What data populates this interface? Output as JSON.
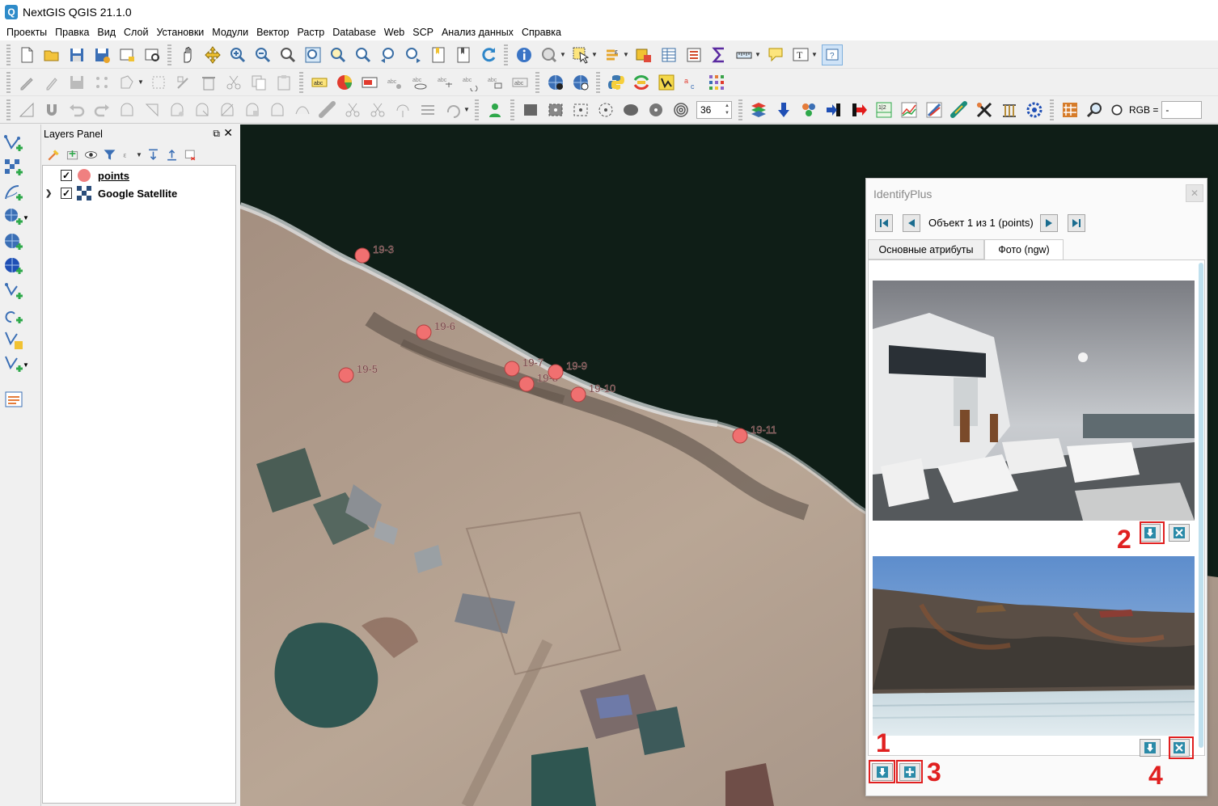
{
  "window": {
    "title": "NextGIS QGIS 21.1.0"
  },
  "menu": [
    "Проекты",
    "Правка",
    "Вид",
    "Слой",
    "Установки",
    "Модули",
    "Вектор",
    "Растр",
    "Database",
    "Web",
    "SCP",
    "Анализ данных",
    "Справка"
  ],
  "toolbar": {
    "zoom_value": "36",
    "rgb_label": "RGB =",
    "rgb_value": "-"
  },
  "layers_panel": {
    "title": "Layers Panel",
    "layers": [
      {
        "name": "points",
        "checked": true,
        "symbol_color": "#f08080"
      },
      {
        "name": "Google Satellite",
        "checked": true
      }
    ]
  },
  "map": {
    "point_color": "#f07070",
    "points": [
      {
        "label": "19-3"
      },
      {
        "label": "19-6"
      },
      {
        "label": "19-5"
      },
      {
        "label": "19-7"
      },
      {
        "label": "19-8"
      },
      {
        "label": "19-9"
      },
      {
        "label": "19-10"
      },
      {
        "label": "19-11"
      }
    ]
  },
  "identify": {
    "title": "IdentifyPlus",
    "object_label": "Объект 1 из 1 (points)",
    "tabs": [
      {
        "label": "Основные атрибуты"
      },
      {
        "label": "Фото (ngw)"
      }
    ],
    "active_tab": "Фото (ngw)",
    "annotations": [
      "1",
      "2",
      "3",
      "4"
    ]
  }
}
